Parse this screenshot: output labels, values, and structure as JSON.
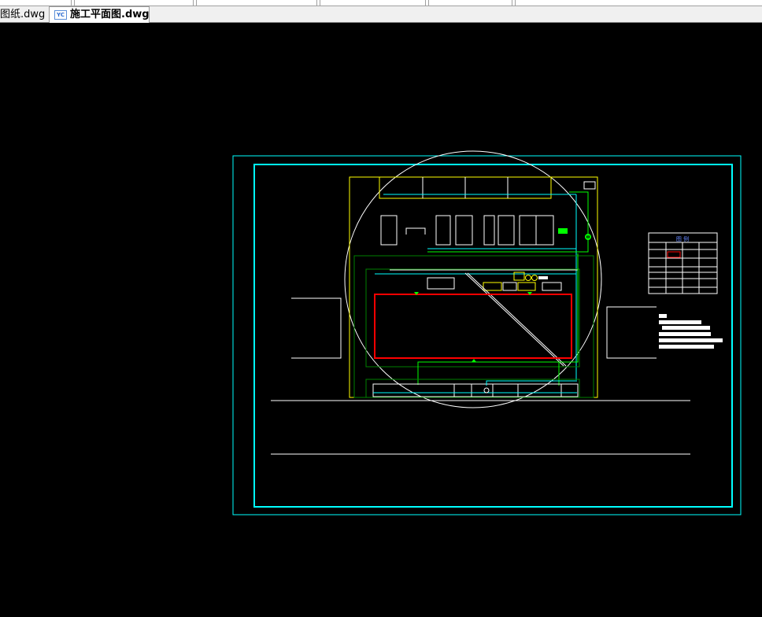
{
  "tabs": [
    {
      "label": "图纸.dwg",
      "active": false
    },
    {
      "label": "施工平面图.dwg",
      "active": true,
      "icon": "yc-file-icon",
      "icon_text": "YC"
    }
  ],
  "drawing": {
    "legend_title": "图 例",
    "colors": {
      "frame": "#00ffff",
      "site": "#ffff00",
      "building": "#ff0000",
      "green": "#00ff00",
      "lines": "#ffffff"
    }
  }
}
